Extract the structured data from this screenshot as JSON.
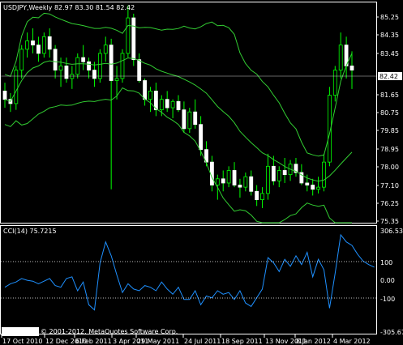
{
  "main_window": {
    "symbol": "USDJPY",
    "timeframe": "Weekly",
    "header_text": "USDJPY,Weekly  82.97 83.30 81.54 82.42",
    "price_axis": [
      "85.25",
      "84.35",
      "83.45",
      "82.42",
      "81.65",
      "80.75",
      "79.85",
      "78.95",
      "78.00",
      "77.10",
      "76.25",
      "75.35"
    ],
    "current_price_label": "82.42"
  },
  "indicator_window": {
    "title": "CCI(14) 75.7215",
    "axis": [
      "306.5339",
      "100",
      "0.00",
      "-100",
      "-305.6729"
    ]
  },
  "time_axis": [
    "17 Oct 2010",
    "12 Dec 2010",
    "6 Feb 2011",
    "3 Apr 2011",
    "29 May 2011",
    "24 Jul 2011",
    "18 Sep 2011",
    "13 Nov 2011",
    "8 Jan 2012",
    "4 Mar 2012"
  ],
  "copyright": "© 2001-2012, MetaQuotes Software Corp.",
  "colors": {
    "background": "#000000",
    "candle_bull": "#00ff00",
    "candle_bear": "#ffffff",
    "bollinger": "#32cd32",
    "cci_line": "#1e90ff",
    "grid_text": "#ffffff"
  },
  "chart_data": [
    {
      "type": "line",
      "title": "USDJPY,Weekly",
      "series": [
        {
          "name": "OHLC",
          "values": [
            [
              81.4,
              81.8,
              80.6,
              81.0
            ],
            [
              81.0,
              81.3,
              80.4,
              80.8
            ],
            [
              80.8,
              82.6,
              80.5,
              82.4
            ],
            [
              82.4,
              83.6,
              82.0,
              83.4
            ],
            [
              83.4,
              84.2,
              83.0,
              83.8
            ],
            [
              83.8,
              84.4,
              83.2,
              83.6
            ],
            [
              83.6,
              84.0,
              82.8,
              83.2
            ],
            [
              83.2,
              84.2,
              83.0,
              84.0
            ],
            [
              84.0,
              84.4,
              83.0,
              83.4
            ],
            [
              83.4,
              83.6,
              82.0,
              82.4
            ],
            [
              82.4,
              83.0,
              81.6,
              82.6
            ],
            [
              82.6,
              83.0,
              81.8,
              82.0
            ],
            [
              82.0,
              82.6,
              81.5,
              82.2
            ],
            [
              82.2,
              83.2,
              82.0,
              83.0
            ],
            [
              83.0,
              83.6,
              82.4,
              82.8
            ],
            [
              82.8,
              83.0,
              82.0,
              82.4
            ],
            [
              82.4,
              82.8,
              81.6,
              82.0
            ],
            [
              82.0,
              83.4,
              81.8,
              83.2
            ],
            [
              83.2,
              84.0,
              82.8,
              83.6
            ],
            [
              83.6,
              83.9,
              76.7,
              81.9
            ],
            [
              81.9,
              82.6,
              81.0,
              82.0
            ],
            [
              82.0,
              83.4,
              81.8,
              83.2
            ],
            [
              83.2,
              85.5,
              83.0,
              84.9
            ],
            [
              84.9,
              85.1,
              82.6,
              82.9
            ],
            [
              82.9,
              83.2,
              81.8,
              81.9
            ],
            [
              81.9,
              82.0,
              80.7,
              81.0
            ],
            [
              81.0,
              81.6,
              80.4,
              81.4
            ],
            [
              81.4,
              81.8,
              80.2,
              80.5
            ],
            [
              80.5,
              81.2,
              80.2,
              81.0
            ],
            [
              81.0,
              81.4,
              80.4,
              80.6
            ],
            [
              80.6,
              81.0,
              80.1,
              80.9
            ],
            [
              80.9,
              81.2,
              80.4,
              80.5
            ],
            [
              80.5,
              80.9,
              79.4,
              79.6
            ],
            [
              79.6,
              80.6,
              79.4,
              80.4
            ],
            [
              80.4,
              81.0,
              79.6,
              79.8
            ],
            [
              79.8,
              80.2,
              78.3,
              78.6
            ],
            [
              78.6,
              79.0,
              77.8,
              78.0
            ],
            [
              78.0,
              78.3,
              76.6,
              76.9
            ],
            [
              76.9,
              77.4,
              76.2,
              77.2
            ],
            [
              77.2,
              77.6,
              76.6,
              77.0
            ],
            [
              77.0,
              77.8,
              76.8,
              77.6
            ],
            [
              77.6,
              78.0,
              76.8,
              76.9
            ],
            [
              76.9,
              77.2,
              76.3,
              76.8
            ],
            [
              76.8,
              77.5,
              76.6,
              77.3
            ],
            [
              77.3,
              77.6,
              76.4,
              76.6
            ],
            [
              76.6,
              76.9,
              75.9,
              76.2
            ],
            [
              76.2,
              76.8,
              75.8,
              76.5
            ],
            [
              76.5,
              78.4,
              76.2,
              77.8
            ],
            [
              77.8,
              78.3,
              76.9,
              77.1
            ],
            [
              77.1,
              77.8,
              76.8,
              77.6
            ],
            [
              77.6,
              78.2,
              77.0,
              77.4
            ],
            [
              77.4,
              78.1,
              77.1,
              77.9
            ],
            [
              77.9,
              78.2,
              77.3,
              77.5
            ],
            [
              77.5,
              77.9,
              76.9,
              77.0
            ],
            [
              77.0,
              77.4,
              76.6,
              76.9
            ],
            [
              76.9,
              77.2,
              76.4,
              76.7
            ],
            [
              76.7,
              77.3,
              76.5,
              76.8
            ],
            [
              76.8,
              78.4,
              76.6,
              78.0
            ],
            [
              78.0,
              81.6,
              77.8,
              81.2
            ],
            [
              81.2,
              82.6,
              80.9,
              82.4
            ],
            [
              82.4,
              84.2,
              82.0,
              83.6
            ],
            [
              83.6,
              84.0,
              82.0,
              82.6
            ],
            [
              82.6,
              83.3,
              81.5,
              82.4
            ]
          ]
        },
        {
          "name": "Bollinger",
          "values": []
        },
        {
          "name": "CCI(14)",
          "values": [
            -40,
            -20,
            -10,
            10,
            0,
            -5,
            -20,
            -5,
            10,
            -30,
            -40,
            10,
            20,
            -60,
            -10,
            -140,
            -170,
            100,
            220,
            140,
            30,
            -70,
            -20,
            -50,
            -60,
            -30,
            -40,
            -60,
            -10,
            -50,
            -80,
            -40,
            -110,
            -110,
            -60,
            -140,
            -90,
            -100,
            -60,
            -80,
            -70,
            -110,
            -60,
            -130,
            -150,
            -100,
            -50,
            130,
            100,
            50,
            120,
            80,
            140,
            90,
            160,
            20,
            120,
            60,
            -160,
            40,
            260,
            220,
            200,
            150,
            110,
            90,
            75
          ]
        }
      ],
      "price_ylim": [
        75.1,
        85.6
      ],
      "cci_ylim": [
        -305.6729,
        306.5339
      ],
      "grid": false
    }
  ]
}
